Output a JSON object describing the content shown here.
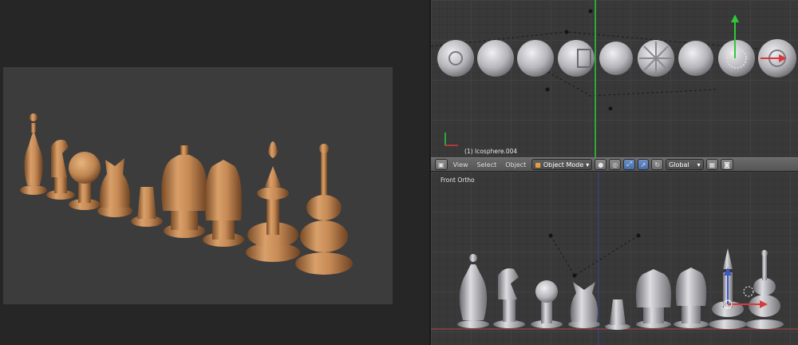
{
  "render_panel": {
    "pieces": [
      "pawn",
      "knight",
      "sphere-pawn",
      "horse-head",
      "column",
      "crown",
      "queen",
      "spire",
      "bishop"
    ]
  },
  "top_viewport": {
    "object_label": "(1) Icosphere.004",
    "sphere_count": 9
  },
  "header": {
    "view_menu": "View",
    "select_menu": "Select",
    "object_menu": "Object",
    "mode": "Object Mode",
    "orientation": "Global"
  },
  "bottom_viewport": {
    "view_label": "Front Ortho"
  },
  "colors": {
    "wood": "#c38956",
    "clay": "#b6b6ba",
    "grid": "#393939",
    "y_axis": "#2fc83a",
    "x_axis": "#d83a3a"
  }
}
